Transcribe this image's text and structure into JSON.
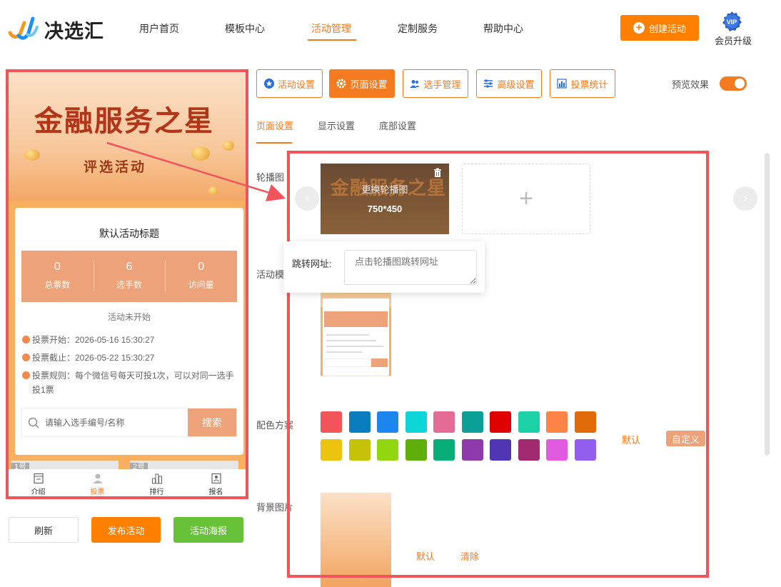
{
  "header": {
    "logo_text": "决选汇",
    "nav": [
      "用户首页",
      "模板中心",
      "活动管理",
      "定制服务",
      "帮助中心"
    ],
    "create_label": "创建活动",
    "vip_badge": "VIP",
    "vip_label": "会员升级"
  },
  "preview": {
    "banner_title": "金融服务之星",
    "banner_subtitle": "评选活动",
    "card_title": "默认活动标题",
    "stats": [
      {
        "value": "0",
        "label": "总票数"
      },
      {
        "value": "6",
        "label": "选手数"
      },
      {
        "value": "0",
        "label": "访问量"
      }
    ],
    "status": "活动未开始",
    "vote_start": "投票开始：2026-05-16 15:30:27",
    "vote_end": "投票截止：2026-05-22 15:30:27",
    "vote_rule": "投票规则：每个微信号每天可投1次，可以对同一选手投1票",
    "search_placeholder": "请输入选手编号/名称",
    "search_button": "搜索",
    "peek_labels": [
      "1号",
      "2号"
    ],
    "tabs": [
      "介绍",
      "投票",
      "排行",
      "报名"
    ]
  },
  "actions": {
    "refresh": "刷新",
    "publish": "发布活动",
    "poster": "活动海报"
  },
  "toolbar": {
    "buttons": [
      "活动设置",
      "页面设置",
      "选手管理",
      "高级设置",
      "投票统计"
    ],
    "preview_label": "预览效果"
  },
  "subtabs": [
    "页面设置",
    "显示设置",
    "底部设置"
  ],
  "settings": {
    "carousel_label": "轮播图",
    "carousel_replace": "更换轮播图",
    "carousel_size": "750*450",
    "add_symbol": "+",
    "jump_label": "跳转网址:",
    "jump_placeholder": "点击轮播图跳转网址",
    "template_label": "活动模",
    "color_label": "配色方案",
    "color_default": "默认",
    "color_custom": "自定义",
    "bg_label": "背景图片",
    "bg_default": "默认",
    "bg_clear": "清除",
    "prev_arrow": "‹",
    "next_arrow": "›"
  },
  "colors": {
    "accent": "#f47b20",
    "swatches_row1": [
      "#f2545b",
      "#0a7dbf",
      "#1c86ee",
      "#0dd5d8",
      "#e36b96",
      "#0aa096",
      "#e00000",
      "#1bd1a5",
      "#fd8346",
      "#e06a08"
    ],
    "swatches_row2": [
      "#ecc30e",
      "#c5c20a",
      "#92d610",
      "#60ae0a",
      "#09ad77",
      "#8e3aaa",
      "#4f35b2",
      "#a0296f",
      "#e15be1",
      "#915eee"
    ]
  },
  "icons": {
    "toolbar": [
      "star-icon",
      "gear-icon",
      "users-icon",
      "sliders-icon",
      "bar-chart-icon"
    ],
    "tabs": [
      "intro-icon",
      "vote-icon",
      "rank-icon",
      "signup-icon"
    ]
  }
}
